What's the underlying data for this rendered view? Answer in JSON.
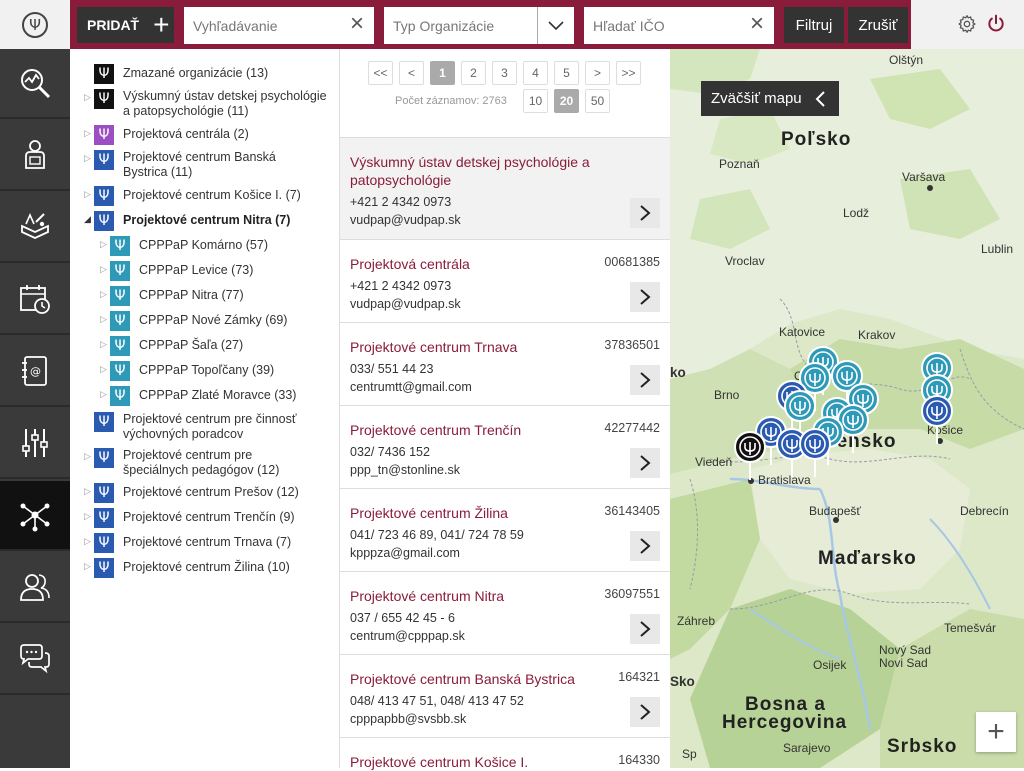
{
  "header": {
    "add_label": "PRIDAŤ",
    "search_placeholder": "Vyhľadávanie",
    "type_placeholder": "Typ Organizácie",
    "ico_placeholder": "Hľadať IČO",
    "filter_label": "Filtruj",
    "cancel_label": "Zrušiť"
  },
  "nav": {
    "items": [
      {
        "name": "analytics-icon"
      },
      {
        "name": "profile-icon"
      },
      {
        "name": "book-tools-icon"
      },
      {
        "name": "calendar-clock-icon"
      },
      {
        "name": "address-book-icon"
      },
      {
        "name": "sliders-icon"
      },
      {
        "name": "network-icon"
      },
      {
        "name": "users-icon"
      },
      {
        "name": "chat-icon"
      }
    ],
    "active_index": 6
  },
  "tree": {
    "items": [
      {
        "label": "Zmazané organizácie (13)",
        "color": "#111111",
        "arrow": false,
        "indent": 0
      },
      {
        "label": "Výskumný ústav detskej psychológie a patopsychológie (11)",
        "color": "#111111",
        "arrow": true,
        "indent": 0
      },
      {
        "label": "Projektová centrála (2)",
        "color": "#9b4fc2",
        "arrow": true,
        "indent": 0
      },
      {
        "label": "Projektové centrum Banská Bystrica (11)",
        "color": "#2a5bb0",
        "arrow": true,
        "indent": 0
      },
      {
        "label": "Projektové centrum Košice I. (7)",
        "color": "#2a5bb0",
        "arrow": true,
        "indent": 0
      },
      {
        "label": "Projektové centrum Nitra (7)",
        "color": "#2a5bb0",
        "arrow": "open",
        "indent": 0,
        "bold": true
      },
      {
        "label": "CPPPaP Komárno (57)",
        "color": "#2e9ab8",
        "arrow": true,
        "indent": 1
      },
      {
        "label": "CPPPaP Levice (73)",
        "color": "#2e9ab8",
        "arrow": true,
        "indent": 1
      },
      {
        "label": "CPPPaP Nitra (77)",
        "color": "#2e9ab8",
        "arrow": true,
        "indent": 1
      },
      {
        "label": "CPPPaP Nové Zámky (69)",
        "color": "#2e9ab8",
        "arrow": true,
        "indent": 1
      },
      {
        "label": "CPPPaP Šaľa (27)",
        "color": "#2e9ab8",
        "arrow": true,
        "indent": 1
      },
      {
        "label": "CPPPaP Topoľčany (39)",
        "color": "#2e9ab8",
        "arrow": true,
        "indent": 1
      },
      {
        "label": "CPPPaP Zlaté Moravce (33)",
        "color": "#2e9ab8",
        "arrow": true,
        "indent": 1
      },
      {
        "label": "Projektové centrum pre činnosť výchovných poradcov",
        "color": "#2a5bb0",
        "arrow": false,
        "indent": 0
      },
      {
        "label": "Projektové centrum pre špeciálnych pedagógov (12)",
        "color": "#2a5bb0",
        "arrow": true,
        "indent": 0
      },
      {
        "label": "Projektové centrum Prešov (12)",
        "color": "#2a5bb0",
        "arrow": true,
        "indent": 0
      },
      {
        "label": "Projektové centrum Trenčín (9)",
        "color": "#2a5bb0",
        "arrow": true,
        "indent": 0
      },
      {
        "label": "Projektové centrum Trnava (7)",
        "color": "#2a5bb0",
        "arrow": true,
        "indent": 0
      },
      {
        "label": "Projektové centrum Žilina (10)",
        "color": "#2a5bb0",
        "arrow": true,
        "indent": 0
      }
    ]
  },
  "pager": {
    "first": "<<",
    "prev": "<",
    "next": ">",
    "last": ">>",
    "pages": [
      "1",
      "2",
      "3",
      "4",
      "5"
    ],
    "current": "1",
    "count_text": "Počet záznamov: 2763",
    "sizes": [
      "10",
      "20",
      "50"
    ],
    "current_size": "20"
  },
  "records": [
    {
      "title": "Výskumný ústav detskej psychológie a patopsychológie",
      "ico": "",
      "phone": "+421 2 4342 0973",
      "email": "vudpap@vudpap.sk"
    },
    {
      "title": "Projektová centrála",
      "ico": "00681385",
      "phone": "+421 2 4342 0973",
      "email": "vudpap@vudpap.sk"
    },
    {
      "title": "Projektové centrum Trnava",
      "ico": "37836501",
      "phone": "033/ 551 44 23",
      "email": "centrumtt@gmail.com"
    },
    {
      "title": "Projektové centrum Trenčín",
      "ico": "42277442",
      "phone": "032/ 7436 152",
      "email": "ppp_tn@stonline.sk"
    },
    {
      "title": "Projektové centrum Žilina",
      "ico": "36143405",
      "phone": "041/ 723 46 89, 041/ 724 78 59",
      "email": "kpppza@gmail.com"
    },
    {
      "title": "Projektové centrum Nitra",
      "ico": "36097551",
      "phone": "037 / 655 42 45 - 6",
      "email": "centrum@cpppap.sk"
    },
    {
      "title": "Projektové centrum Banská Bystrica",
      "ico": "164321",
      "phone": "048/ 413 47 51, 048/ 413 47 52",
      "email": "cpppapbb@svsbb.sk"
    },
    {
      "title": "Projektové centrum Košice I.",
      "ico": "164330",
      "phone": "",
      "email": ""
    }
  ],
  "map": {
    "enlarge_label": "Zväčšiť mapu",
    "zoom_in": "+",
    "labels": [
      {
        "text": "Olštýn"
      },
      {
        "text": "Poľsko"
      },
      {
        "text": "Poznaň"
      },
      {
        "text": "Varšava"
      },
      {
        "text": "Lodž"
      },
      {
        "text": "Vroclav"
      },
      {
        "text": "Lublin"
      },
      {
        "text": "Katovice"
      },
      {
        "text": "Krakov"
      },
      {
        "text": "Os"
      },
      {
        "text": "ko"
      },
      {
        "text": "Brno"
      },
      {
        "text": "Viedeň"
      },
      {
        "text": "Bratislava"
      },
      {
        "text": "vensko"
      },
      {
        "text": "Košice"
      },
      {
        "text": "Budapešť"
      },
      {
        "text": "Debrecín"
      },
      {
        "text": "Maďarsko"
      },
      {
        "text": "Záhreb"
      },
      {
        "text": "Temešvár"
      },
      {
        "text": "Nový Sad"
      },
      {
        "text": "Novi Sad"
      },
      {
        "text": "Osijek"
      },
      {
        "text": "Sko"
      },
      {
        "text": "Bosna a"
      },
      {
        "text": "Hercegovina"
      },
      {
        "text": "Srbsko"
      },
      {
        "text": "Sarajevo"
      },
      {
        "text": "Sp"
      }
    ]
  },
  "colors": {
    "brand": "#8a1c3b",
    "dark": "#333333",
    "marker_blue": "#2a5bb0",
    "marker_teal": "#2e9ab8",
    "marker_black": "#111111"
  }
}
